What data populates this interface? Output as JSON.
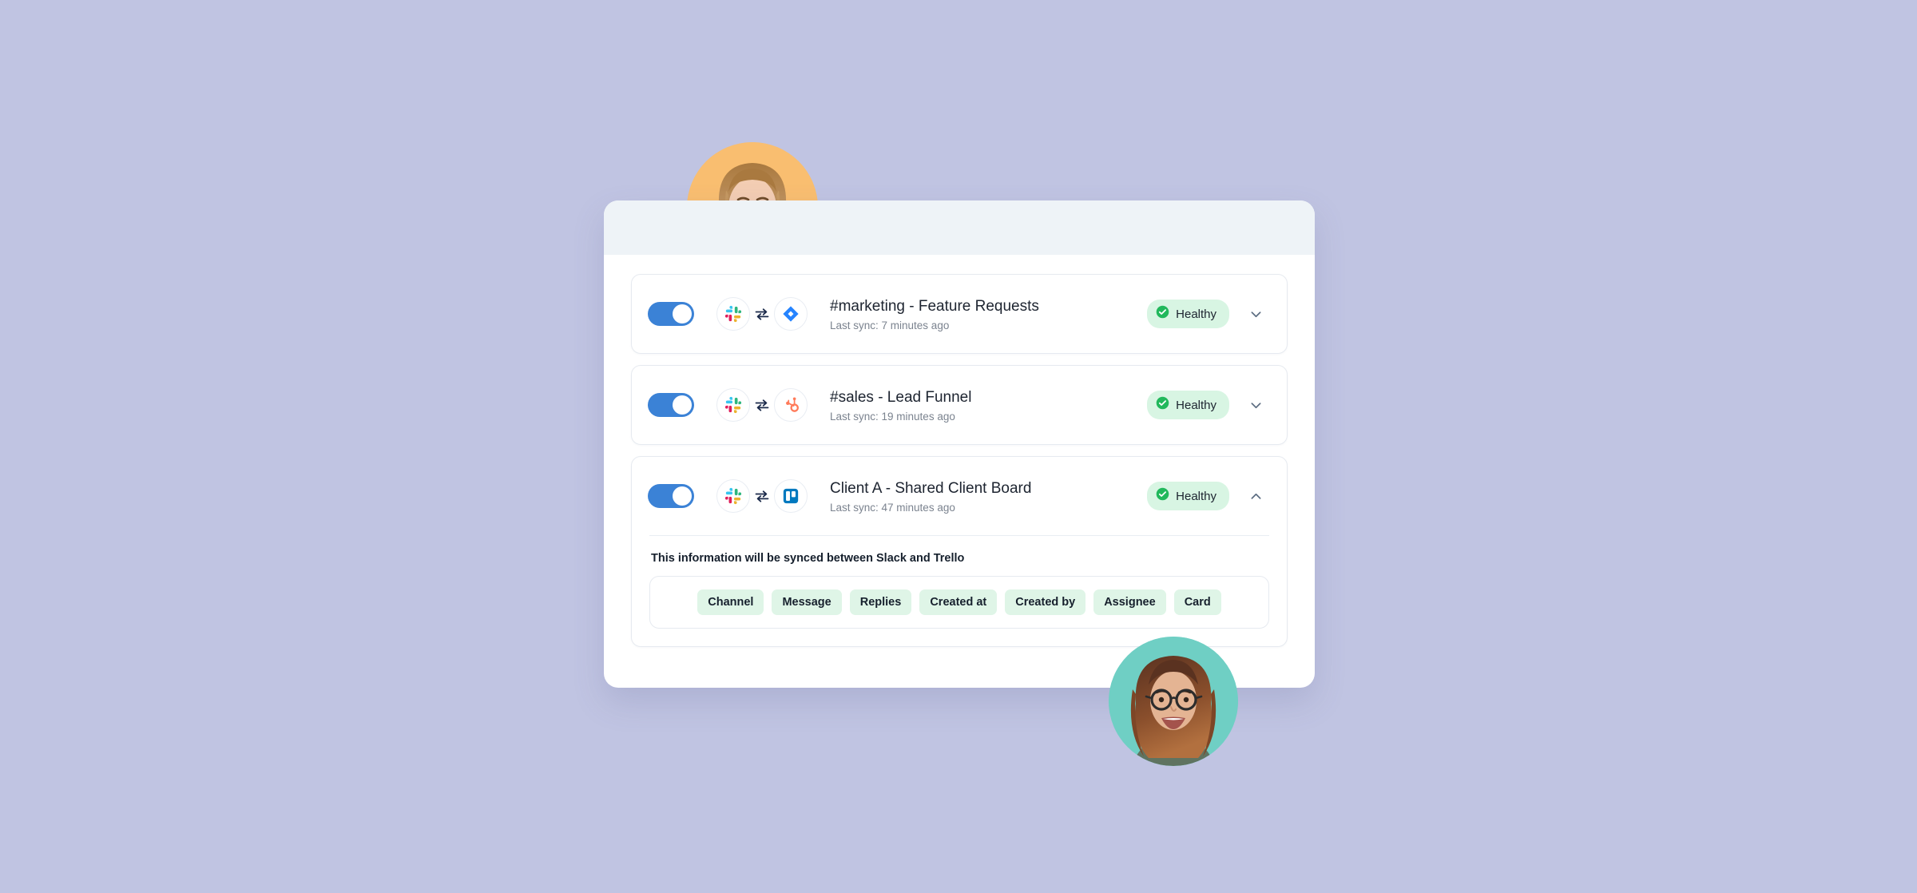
{
  "background_color": "#c0c4e2",
  "panel": {
    "header_color": "#eef3f7",
    "surface_color": "#ffffff"
  },
  "colors": {
    "toggle_on": "#3b82d6",
    "status_pill_bg": "#d8f5e3",
    "status_check_green": "#22b85c",
    "field_tag_bg": "#dff5e7",
    "slack_blue": "#36c5f0",
    "slack_green": "#2eb67d",
    "slack_red": "#e01e5a",
    "slack_yellow": "#ecb22e",
    "jira_blue": "#2684ff",
    "hubspot_orange": "#ff7a59",
    "trello_blue": "#0079bf",
    "avatar_top_bg": "#f9be70",
    "avatar_bottom_bg": "#6fcfc4"
  },
  "rows": [
    {
      "toggle_on": true,
      "source_app": "slack",
      "target_app": "jira",
      "sync_direction": "bidirectional",
      "title": "#marketing - Feature Requests",
      "subtitle": "Last sync: 7 minutes ago",
      "status": "Healthy",
      "expanded": false,
      "chevron": "chevron-down"
    },
    {
      "toggle_on": true,
      "source_app": "slack",
      "target_app": "hubspot",
      "sync_direction": "bidirectional",
      "title": "#sales - Lead Funnel",
      "subtitle": "Last sync: 19 minutes ago",
      "status": "Healthy",
      "expanded": false,
      "chevron": "chevron-down"
    },
    {
      "toggle_on": true,
      "source_app": "slack",
      "target_app": "trello",
      "sync_direction": "bidirectional",
      "title": "Client A - Shared Client Board",
      "subtitle": "Last sync: 47 minutes ago",
      "status": "Healthy",
      "expanded": true,
      "chevron": "chevron-up"
    }
  ],
  "expanded_detail": {
    "heading": "This information will be synced between Slack and Trello",
    "fields": [
      "Channel",
      "Message",
      "Replies",
      "Created at",
      "Created by",
      "Assignee",
      "Card"
    ]
  },
  "avatars": [
    {
      "name": "avatar-top",
      "background": "#f9be70"
    },
    {
      "name": "avatar-bottom",
      "background": "#6fcfc4"
    }
  ]
}
